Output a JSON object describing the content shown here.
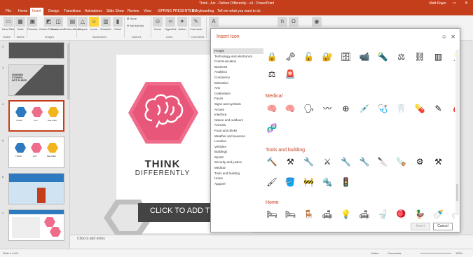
{
  "titlebar": {
    "title": "Think - Act - Deliver Differently - v4 - PowerPoint",
    "user": "Matt Royer",
    "controls": "─ ▭ ✕"
  },
  "tabs": [
    {
      "label": "File"
    },
    {
      "label": "Home"
    },
    {
      "label": "Insert"
    },
    {
      "label": "Design"
    },
    {
      "label": "Transitions"
    },
    {
      "label": "Animations"
    },
    {
      "label": "Slide Show"
    },
    {
      "label": "Review"
    },
    {
      "label": "View"
    },
    {
      "label": "iSPRING PRESENTER 7"
    },
    {
      "label": "Storyboarding"
    },
    {
      "label": "Tell me what you want to do"
    }
  ],
  "ribbon": {
    "buttons": [
      {
        "label": "New Slide",
        "icon": "▭"
      },
      {
        "label": "Table",
        "icon": "▦"
      },
      {
        "label": "Pictures",
        "icon": "▣"
      },
      {
        "label": "Online Pictures",
        "icon": "◩"
      },
      {
        "label": "Screenshot",
        "icon": "◫"
      },
      {
        "label": "Photo Album",
        "icon": "▤"
      },
      {
        "label": "Shapes",
        "icon": "△"
      },
      {
        "label": "Icons",
        "icon": "☺"
      },
      {
        "label": "SmartArt",
        "icon": "▥"
      },
      {
        "label": "Chart",
        "icon": "▮"
      },
      {
        "label": "Store",
        "icon": "⊞"
      },
      {
        "label": "My Add-ins",
        "icon": "⊕"
      },
      {
        "label": "Zoom",
        "icon": "⊙"
      },
      {
        "label": "Hyperlink",
        "icon": "∞"
      },
      {
        "label": "Action",
        "icon": "✦"
      },
      {
        "label": "Comment",
        "icon": "✎"
      },
      {
        "label": "Text",
        "icon": "A"
      },
      {
        "label": "Equation",
        "icon": "π"
      },
      {
        "label": "Symbol",
        "icon": "Ω"
      },
      {
        "label": "Media",
        "icon": "◉"
      }
    ],
    "groups": [
      "Slides",
      "Tables",
      "Images",
      "Illustrations",
      "Add-ins",
      "Links",
      "Comments",
      "Text",
      "Symbols",
      "Media"
    ]
  },
  "thumbs": [
    {
      "num": "2"
    },
    {
      "num": "3"
    },
    {
      "num": "4"
    },
    {
      "num": "5"
    },
    {
      "num": "6"
    },
    {
      "num": "7"
    }
  ],
  "thumb_texts": {
    "t3": "SHARING\nSTORIES,\nNOT SLIDES",
    "labels": [
      "THINK",
      "ACT",
      "DELIVER"
    ]
  },
  "slide": {
    "think": "THINK",
    "differently": "DIFFERENTLY",
    "click_to_add": "CLICK TO ADD TI"
  },
  "notes": {
    "placeholder": "Click to add notes"
  },
  "status": {
    "slide": "Slide 4 of 24",
    "notes": "Notes",
    "comments": "Comments",
    "zoom": "115%"
  },
  "dialog": {
    "title": "Insert Icon",
    "categories": [
      "People",
      "Technology and electronics",
      "Communication",
      "Business",
      "Analytics",
      "Commerce",
      "Education",
      "Arts",
      "Celebration",
      "Faces",
      "Signs and symbols",
      "Arrows",
      "Interface",
      "Nature and outdoors",
      "Animals",
      "Food and drinks",
      "Weather and seasons",
      "Location",
      "Vehicles",
      "Buildings",
      "Sports",
      "Security and justice",
      "Medical",
      "Tools and building",
      "Home",
      "Apparel"
    ],
    "sections": {
      "medical": "Medical",
      "tools": "Tools and building",
      "home": "Home"
    },
    "rows": {
      "security1": [
        "🔒",
        "🗝",
        "🔓",
        "🔐",
        "🗄",
        "📹",
        "🔦",
        "⚖",
        "⛓",
        "▥",
        "🏃"
      ],
      "security2": [
        "⚖",
        "🚨"
      ],
      "medical1": [
        "🧠",
        "🧠",
        "🗣",
        "〰",
        "⊕",
        "💉",
        "🩺",
        "🦷",
        "💊",
        "✎",
        "🩸"
      ],
      "medical2": [
        "🧬"
      ],
      "tools1": [
        "🔨",
        "⚒",
        "🔧",
        "⚔",
        "🔧",
        "🔧",
        "🔪",
        "🪚",
        "⚙",
        "⚒"
      ],
      "tools2": [
        "🖌",
        "🪣",
        "🚧",
        "🔩",
        "🚦"
      ],
      "home1": [
        "🛏",
        "🛏",
        "🪑",
        "🛋",
        "💡",
        "🛋",
        "🚽",
        "🪀",
        "🦆",
        "🍼",
        "🍼",
        "🧹"
      ]
    },
    "insert_label": "Insert",
    "cancel_label": "Cancel",
    "smile_icon": "☺",
    "close_icon": "✕"
  }
}
